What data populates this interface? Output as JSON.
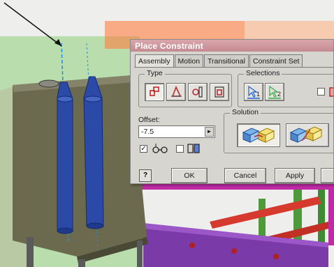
{
  "dialog": {
    "title": "Place Constraint",
    "tabs": [
      {
        "label": "Assembly",
        "active": true
      },
      {
        "label": "Motion",
        "active": false
      },
      {
        "label": "Transitional",
        "active": false
      },
      {
        "label": "Constraint Set",
        "active": false
      }
    ],
    "type_group_label": "Type",
    "type_buttons": [
      "mate-icon",
      "angle-icon",
      "tangent-icon",
      "insert-icon"
    ],
    "selections_group_label": "Selections",
    "selection_buttons": [
      {
        "label": "1",
        "color": "#1f5fd0"
      },
      {
        "label": "2",
        "color": "#3aa64a"
      }
    ],
    "offset_label": "Offset:",
    "offset_value": "-7.5",
    "solution_group_label": "Solution",
    "show_preview_checked": true,
    "predict_offset_checked": false,
    "buttons": {
      "help": "?",
      "ok": "OK",
      "cancel": "Cancel",
      "apply": "Apply"
    }
  },
  "colors": {
    "title_bar": "#c48a91",
    "dialog_bg": "#d7d5cf",
    "pin_blue": "#2b4aa8",
    "plate": "#6b6a4e",
    "magenta_frame": "#c02aa6",
    "purple_beam": "#7a3aa8",
    "red_rod": "#d63a2e",
    "green_post": "#4e9a3a"
  }
}
